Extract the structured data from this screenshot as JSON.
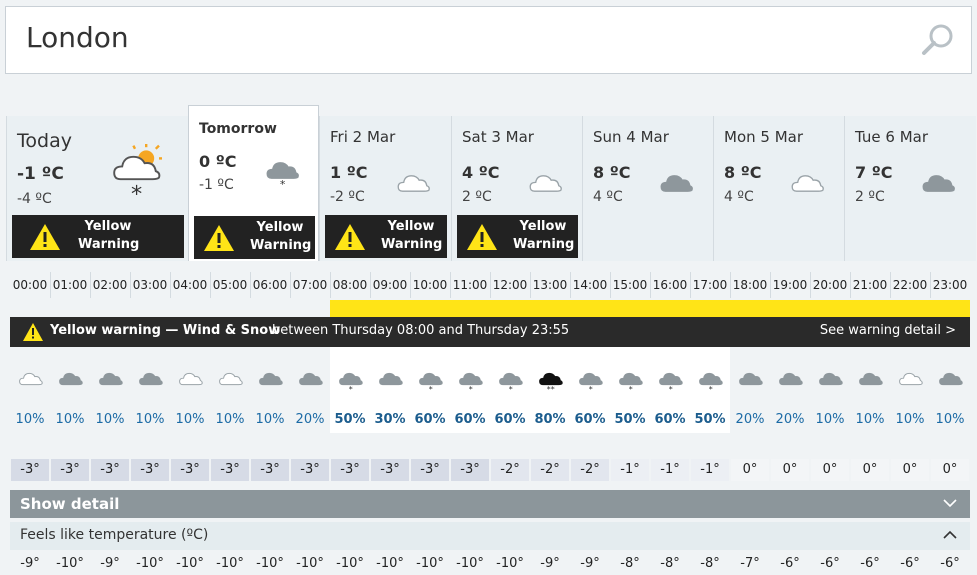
{
  "search": {
    "value": "London"
  },
  "days": [
    {
      "name": "Today",
      "max": "-1 ºC",
      "min": "-4 ºC",
      "icon": "sun-cloud-snow-icon",
      "warning": [
        "Yellow",
        "Warning"
      ]
    },
    {
      "name": "Tomorrow",
      "max": "0 ºC",
      "min": "-1 ºC",
      "icon": "cloud-snow-icon",
      "warning": [
        "Yellow",
        "Warning"
      ]
    },
    {
      "name": "Fri 2 Mar",
      "max": "1 ºC",
      "min": "-2 ºC",
      "icon": "light-cloud-icon",
      "warning": [
        "Yellow",
        "Warning"
      ]
    },
    {
      "name": "Sat 3 Mar",
      "max": "4 ºC",
      "min": "2 ºC",
      "icon": "light-cloud-icon",
      "warning": [
        "Yellow",
        "Warning"
      ]
    },
    {
      "name": "Sun 4 Mar",
      "max": "8 ºC",
      "min": "4 ºC",
      "icon": "cloud-icon"
    },
    {
      "name": "Mon 5 Mar",
      "max": "8 ºC",
      "min": "4 ºC",
      "icon": "light-cloud-icon"
    },
    {
      "name": "Tue 6 Mar",
      "max": "7 ºC",
      "min": "2 ºC",
      "icon": "cloud-icon"
    }
  ],
  "hours": [
    "00:00",
    "01:00",
    "02:00",
    "03:00",
    "04:00",
    "05:00",
    "06:00",
    "07:00",
    "08:00",
    "09:00",
    "10:00",
    "11:00",
    "12:00",
    "13:00",
    "14:00",
    "15:00",
    "16:00",
    "17:00",
    "18:00",
    "19:00",
    "20:00",
    "21:00",
    "22:00",
    "23:00"
  ],
  "warning_banner": {
    "title": "Yellow warning — Wind & Snow",
    "time": "between Thursday 08:00 and Thursday 23:55",
    "link": "See warning detail >"
  },
  "hourly_icons": [
    "light-cloud",
    "cloud",
    "cloud",
    "cloud",
    "light-cloud",
    "light-cloud",
    "cloud",
    "cloud",
    "cloud-snow",
    "cloud",
    "cloud-snow",
    "cloud-snow",
    "cloud-snow",
    "dark-cloud-heavy-snow",
    "cloud-snow",
    "cloud-snow",
    "cloud-snow",
    "cloud-snow",
    "cloud",
    "cloud",
    "cloud",
    "cloud",
    "light-cloud",
    "cloud"
  ],
  "precip": [
    "10%",
    "10%",
    "10%",
    "10%",
    "10%",
    "10%",
    "10%",
    "20%",
    "50%",
    "30%",
    "60%",
    "60%",
    "60%",
    "80%",
    "60%",
    "50%",
    "60%",
    "50%",
    "20%",
    "20%",
    "10%",
    "10%",
    "10%",
    "10%"
  ],
  "temps": [
    "-3°",
    "-3°",
    "-3°",
    "-3°",
    "-3°",
    "-3°",
    "-3°",
    "-3°",
    "-3°",
    "-3°",
    "-3°",
    "-3°",
    "-2°",
    "-2°",
    "-2°",
    "-1°",
    "-1°",
    "-1°",
    "0°",
    "0°",
    "0°",
    "0°",
    "0°",
    "0°"
  ],
  "show_detail": "Show detail",
  "feels_like_label": "Feels like temperature (ºC)",
  "feels": [
    "-9°",
    "-10°",
    "-9°",
    "-10°",
    "-10°",
    "-10°",
    "-10°",
    "-10°",
    "-10°",
    "-10°",
    "-10°",
    "-10°",
    "-10°",
    "-9°",
    "-9°",
    "-8°",
    "-8°",
    "-8°",
    "-7°",
    "-6°",
    "-6°",
    "-6°",
    "-6°",
    "-6°"
  ],
  "colors": {
    "warning_yellow": "#ffe417",
    "warning_dark": "#222222",
    "precip_blue": "#1b6aa5",
    "detail_bar": "#8c969b"
  }
}
